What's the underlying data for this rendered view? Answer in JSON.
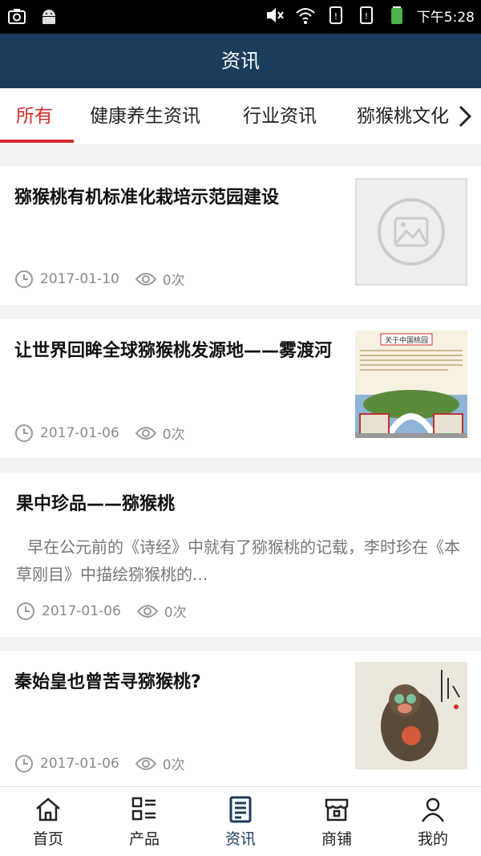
{
  "status": {
    "time": "下午5:28"
  },
  "header": {
    "title": "资讯"
  },
  "tabs": [
    "所有",
    "健康养生资讯",
    "行业资讯",
    "猕猴桃文化"
  ],
  "articles": [
    {
      "title": "猕猴桃有机标准化栽培示范园建设",
      "date": "2017-01-10",
      "views": "0次"
    },
    {
      "title": "让世界回眸全球猕猴桃发源地——雾渡河",
      "date": "2017-01-06",
      "views": "0次",
      "thumb_text": "关于中国桃园"
    },
    {
      "title": "果中珍品——猕猴桃",
      "excerpt": "早在公元前的《诗经》中就有了猕猴桃的记载，李时珍在《本草刚目》中描绘猕猴桃的...",
      "date": "2017-01-06",
      "views": "0次"
    },
    {
      "title": "秦始皇也曾苦寻猕猴桃?",
      "date": "2017-01-06",
      "views": "0次"
    }
  ],
  "bottom_nav": [
    "首页",
    "产品",
    "资讯",
    "商铺",
    "我的"
  ],
  "colors": {
    "header_bg": "#1b3d5d",
    "accent_red": "#d32b2b"
  }
}
